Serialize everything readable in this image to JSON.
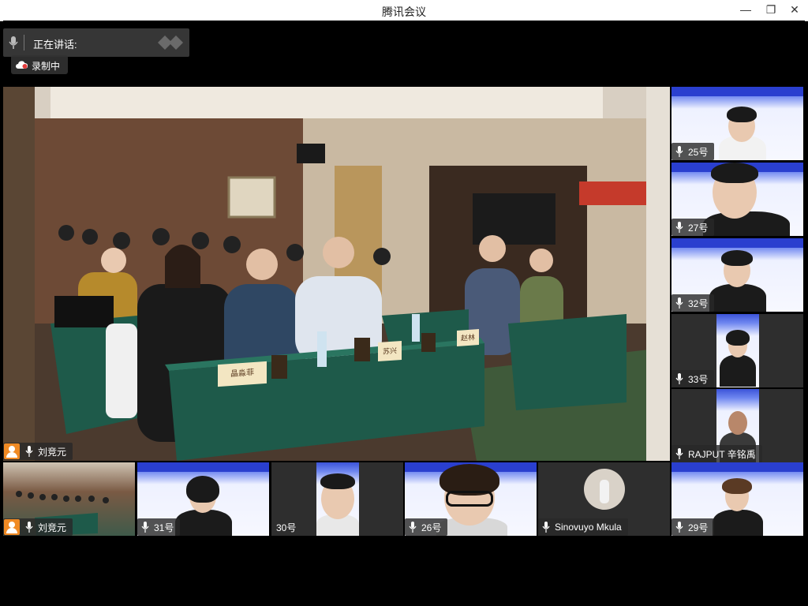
{
  "window": {
    "title": "腾讯会议",
    "minimize_glyph": "—",
    "maximize_glyph": "❐",
    "close_glyph": "✕"
  },
  "speaking": {
    "label": "正在讲话:"
  },
  "recording": {
    "label": "录制中"
  },
  "main_video": {
    "name": "刘竞元",
    "is_host": true,
    "placard_1": "晶淼菲",
    "placard_2": "苏兴",
    "placard_3": "赵林"
  },
  "side_tiles": [
    {
      "name": "25号"
    },
    {
      "name": "27号"
    },
    {
      "name": "32号"
    },
    {
      "name": "33号"
    },
    {
      "name": "RAJPUT 辛铭禹"
    }
  ],
  "bottom_tiles": [
    {
      "name": "刘竞元",
      "is_host": true
    },
    {
      "name": "31号"
    },
    {
      "name": "30号"
    },
    {
      "name": "26号"
    },
    {
      "name": "Sinovuyo Mkula"
    },
    {
      "name": "29号"
    }
  ],
  "colors": {
    "host_badge": "#f08a24",
    "banner_blue": "#3b53d9",
    "label_bg": "#282828"
  }
}
